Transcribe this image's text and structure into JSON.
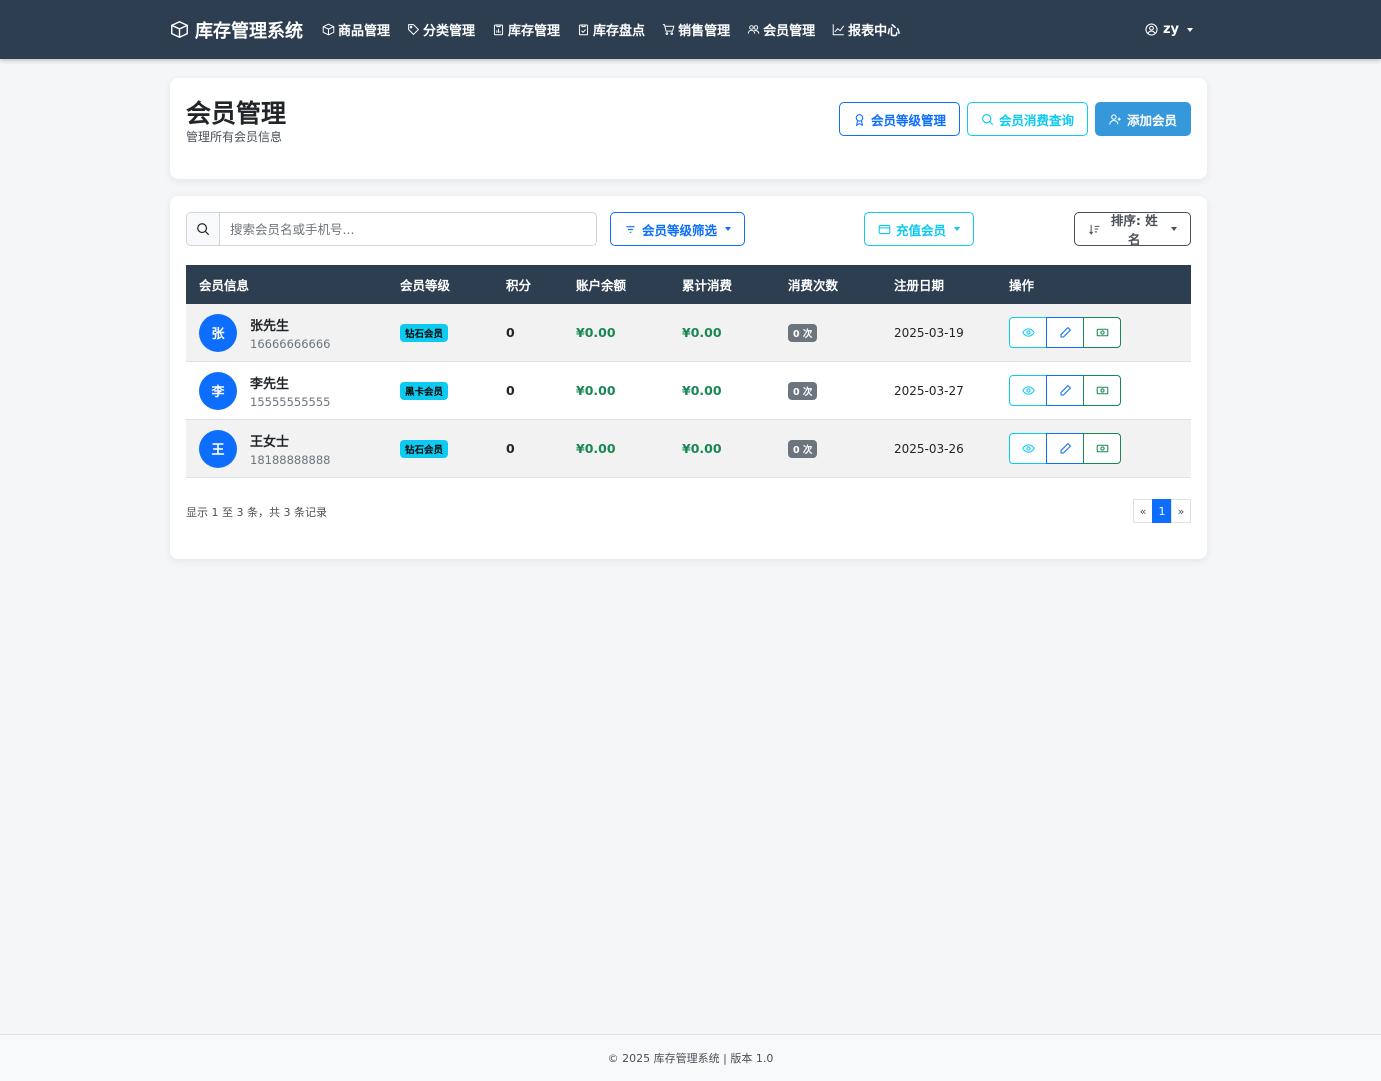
{
  "brand": {
    "title": "库存管理系统",
    "icon": "box-icon"
  },
  "nav": [
    {
      "label": "商品管理",
      "icon": "box-icon"
    },
    {
      "label": "分类管理",
      "icon": "tag-icon"
    },
    {
      "label": "库存管理",
      "icon": "clipboard-data-icon"
    },
    {
      "label": "库存盘点",
      "icon": "clipboard-check-icon"
    },
    {
      "label": "销售管理",
      "icon": "cart-icon"
    },
    {
      "label": "会员管理",
      "icon": "people-icon"
    },
    {
      "label": "报表中心",
      "icon": "graph-icon"
    }
  ],
  "user": {
    "name": "zy",
    "icon": "person-circle-icon"
  },
  "header": {
    "title": "会员管理",
    "subtitle": "管理所有会员信息",
    "level_btn": "会员等级管理",
    "consume_btn": "会员消费查询",
    "add_btn": "添加会员"
  },
  "toolbar": {
    "search_placeholder": "搜索会员名或手机号...",
    "level_filter": "会员等级筛选",
    "recharge": "充值会员",
    "sort": "排序: 姓名"
  },
  "table": {
    "headers": [
      "会员信息",
      "会员等级",
      "积分",
      "账户余额",
      "累计消费",
      "消费次数",
      "注册日期",
      "操作"
    ],
    "rows": [
      {
        "avatar": "张",
        "name": "张先生",
        "phone": "16666666666",
        "level": "钻石会员",
        "points": "0",
        "balance": "¥0.00",
        "spent": "¥0.00",
        "count": "0 次",
        "date": "2025-03-19"
      },
      {
        "avatar": "李",
        "name": "李先生",
        "phone": "15555555555",
        "level": "黑卡会员",
        "points": "0",
        "balance": "¥0.00",
        "spent": "¥0.00",
        "count": "0 次",
        "date": "2025-03-27"
      },
      {
        "avatar": "王",
        "name": "王女士",
        "phone": "18188888888",
        "level": "钻石会员",
        "points": "0",
        "balance": "¥0.00",
        "spent": "¥0.00",
        "count": "0 次",
        "date": "2025-03-26"
      }
    ]
  },
  "pagination": {
    "info": "显示 1 至 3 条，共 3 条记录",
    "prev": "«",
    "current": "1",
    "next": "»"
  },
  "footer": {
    "text": "© 2025 库存管理系统 | 版本 1.0"
  },
  "colors": {
    "navbar": "#2c3e50",
    "primary": "#0d6efd",
    "info": "#0dcaf0",
    "success": "#198754",
    "add_button": "#3498db"
  }
}
